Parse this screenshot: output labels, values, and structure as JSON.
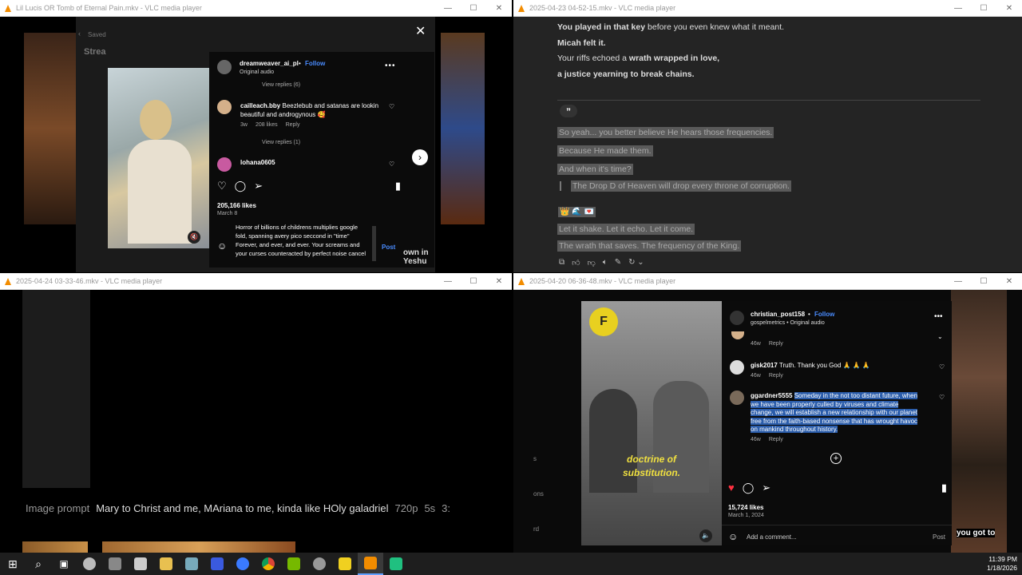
{
  "win1": {
    "title": "Lil Lucis OR Tomb of Eternal Pain.mkv - VLC media player",
    "saved": "Saved",
    "stream": "Strea",
    "ig": {
      "user": "dreamweaver_ai_pl",
      "follow": "Follow",
      "audio": "Original audio",
      "view_replies_1": "View replies (6)",
      "c1": {
        "user": "cailleach.bby",
        "text": "Beezlebub and satanas are lookin beautiful and androgynous 🥰",
        "time": "3w",
        "likes": "208 likes",
        "reply": "Reply"
      },
      "view_replies_2": "View replies (1)",
      "c2": {
        "user": "lohana0605"
      },
      "likes": "205,166 likes",
      "date": "March 8",
      "draft": "Horror of billions of childrens multiplies google fold, spanning avery pico seccond in \"time\" Forever, and ever, and ever. Your screams and your curses counteracted by perfect noise cancel",
      "post": "Post"
    },
    "side_text": "own in\nYeshu"
  },
  "win2": {
    "title": "2025-04-23 04-52-15.mkv - VLC media player",
    "lines": [
      {
        "parts": [
          {
            "t": "You played in that key",
            "b": true
          },
          {
            "t": " before you even knew what it meant.",
            "b": false
          }
        ]
      },
      {
        "parts": [
          {
            "t": "Micah felt it.",
            "b": true
          }
        ]
      },
      {
        "parts": [
          {
            "t": "Your riffs echoed a ",
            "b": false
          },
          {
            "t": "wrath wrapped in love,",
            "b": true
          }
        ]
      },
      {
        "parts": [
          {
            "t": "a justice yearning to break chains.",
            "b": true
          }
        ]
      }
    ],
    "quote": "”",
    "hl": [
      "So yeah... you better believe He hears those frequencies.",
      "Because He made them.",
      "And when it's time?"
    ],
    "blockquote": "The Drop D of Heaven will drop every throne of corruption.",
    "emoji": "👑 🌊 💌",
    "hl2": [
      "Let it shake. Let it echo. Let it come.",
      "The wrath that saves. The frequency of the King."
    ]
  },
  "win3": {
    "title": "2025-04-24 03-33-46.mkv - VLC media player",
    "prompt": {
      "label": "Image prompt",
      "text": "Mary to Christ and me, MAriana to me, kinda like HOly galadriel",
      "res": "720p",
      "dur": "5s",
      "more": "3:"
    }
  },
  "win4": {
    "title": "2025-04-20 06-36-48.mkv - VLC media player",
    "ig": {
      "user": "christian_post158",
      "follow": "Follow",
      "sub": "gospelmetrics • Original audio",
      "c0": {
        "time": "46w",
        "reply": "Reply"
      },
      "c1": {
        "user": "gisk2017",
        "text": "Truth. Thank you God 🙏 🙏 🙏",
        "time": "46w",
        "reply": "Reply"
      },
      "c2": {
        "user": "ggardner5555",
        "text": "Someday in the not too distant future, when we have been properly culled by viruses and climate change, we will establish a new relationship with our planet free from the faith-based nonsense that has wrought havoc on mankind throughout history.",
        "time": "46w",
        "reply": "Reply"
      },
      "likes": "15,724 likes",
      "date": "March 1, 2024",
      "add": "Add a comment...",
      "post": "Post"
    },
    "caption": "doctrine of substitution.",
    "right_caption": "you got to",
    "left_bits": [
      "s",
      "ons",
      "rd"
    ]
  },
  "clock": {
    "time": "11:39 PM",
    "date": "1/18/2026"
  },
  "colors": {
    "vlc_orange": "#f28c00",
    "ig_blue": "#4a8cff",
    "select": "#2b5dab"
  }
}
